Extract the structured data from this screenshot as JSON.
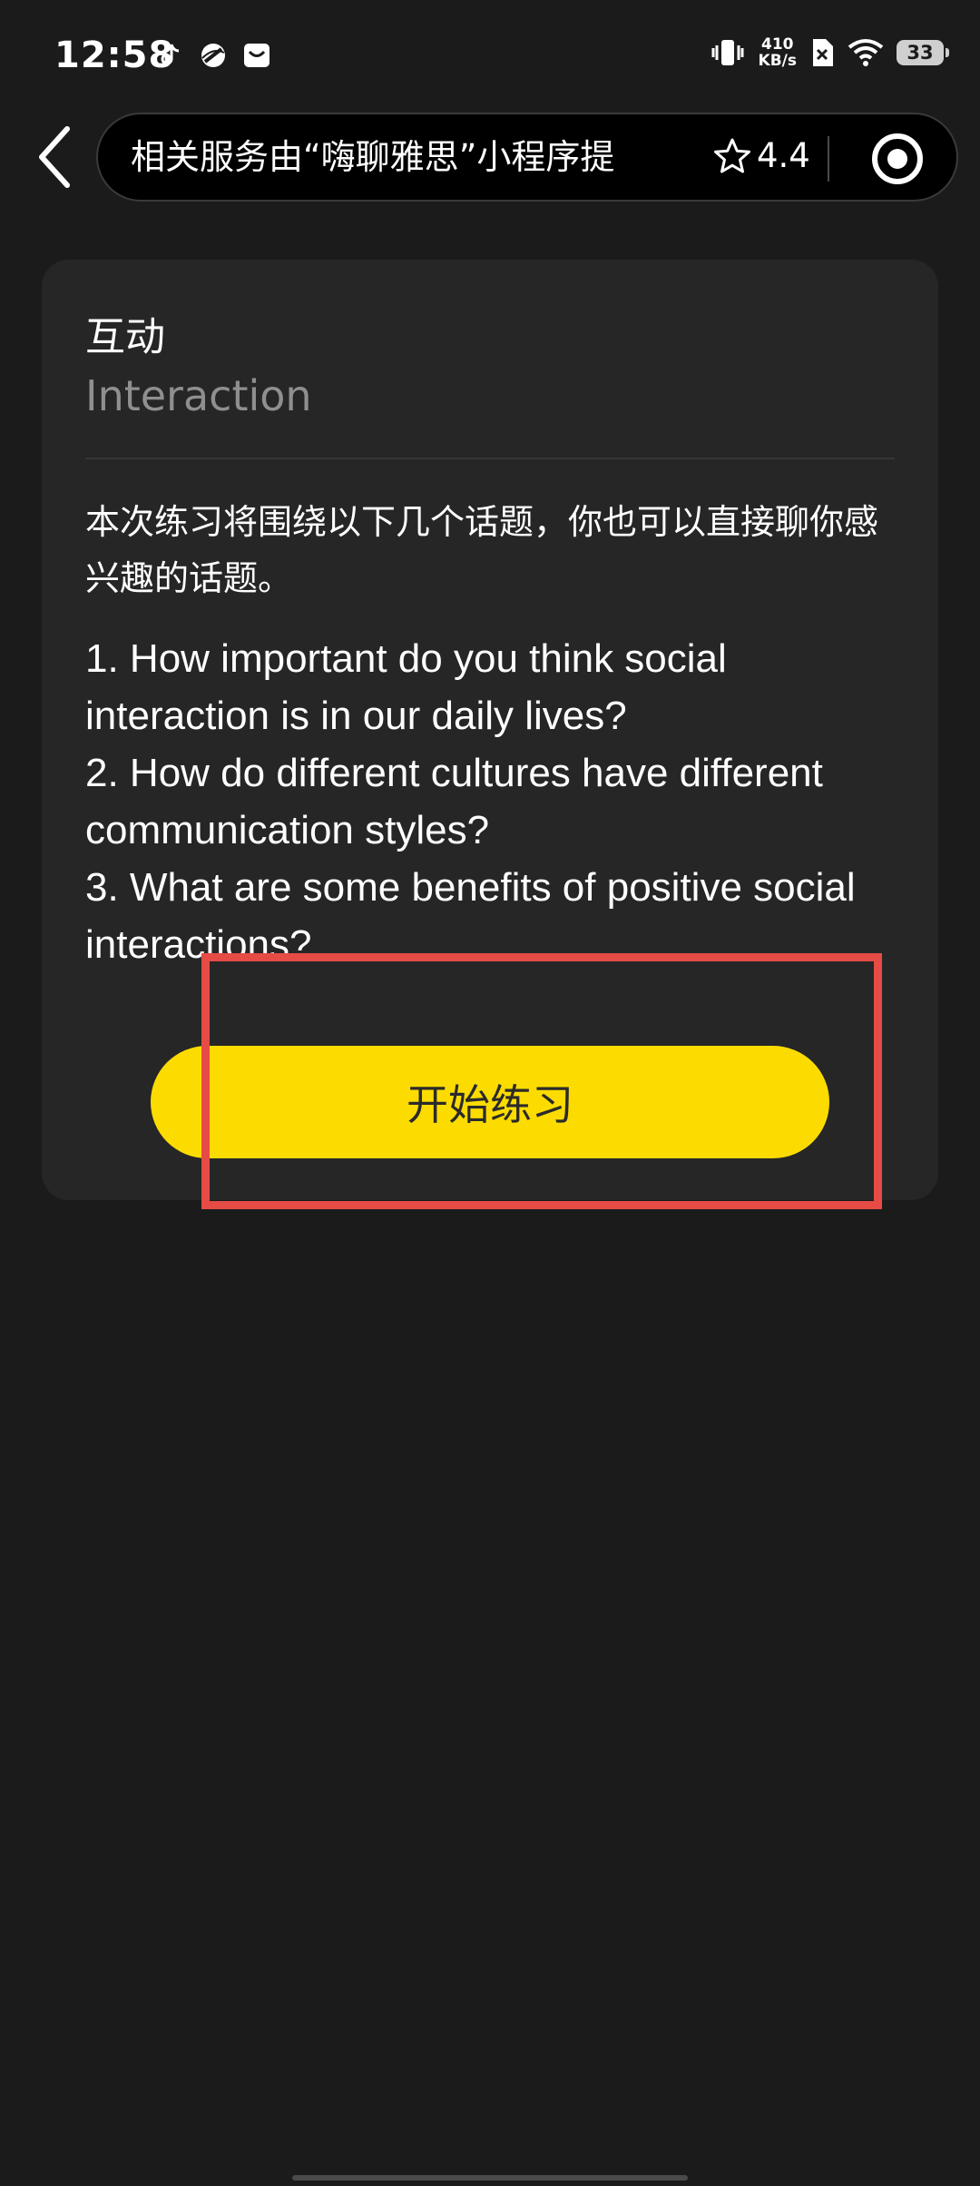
{
  "status_bar": {
    "time": "12:58",
    "app_icons": [
      "tiktok-icon",
      "browser-icon",
      "mail-icon"
    ],
    "net_speed_value": "410",
    "net_speed_unit": "KB/s",
    "battery_level": "33"
  },
  "header": {
    "title": "相关服务由“嗨聊雅思”小程序提",
    "rating": "4.4"
  },
  "card": {
    "title": "互动",
    "subtitle": "Interaction",
    "intro": "本次练习将围绕以下几个话题，你也可以直接聊你感兴趣的话题。",
    "topics": [
      "1. How important do you think social interaction is in our daily lives?",
      "2. How do different cultures have different communication styles?",
      "3. What are some benefits of positive social interactions?"
    ],
    "start_label": "开始练习"
  },
  "colors": {
    "background": "#1b1b1b",
    "card": "#262626",
    "accent_yellow": "#fcdc00",
    "highlight_red": "#e64b45",
    "subtitle_gray": "#8f8f8f"
  }
}
